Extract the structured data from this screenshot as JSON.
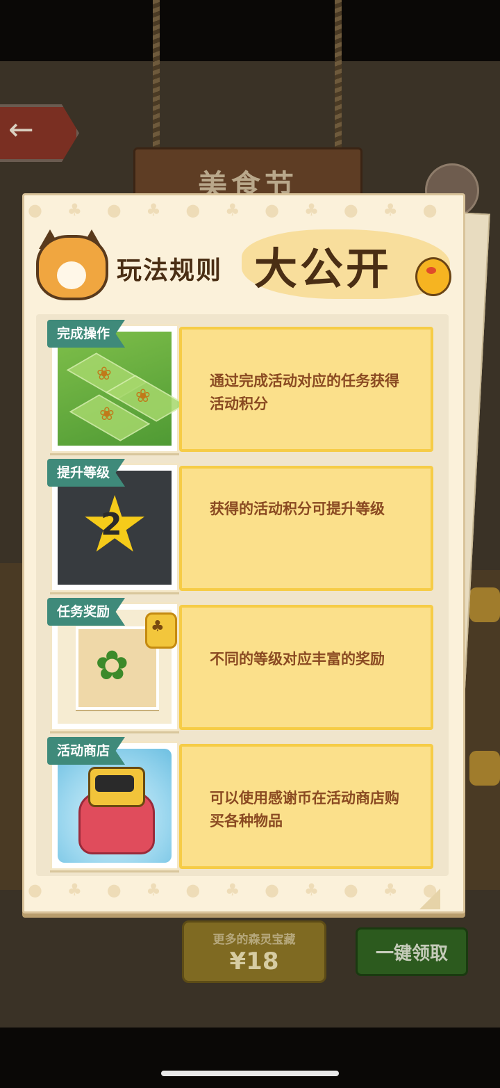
{
  "background": {
    "back_icon": "arrow-left-icon",
    "festival_title": "美食节",
    "more_treasure": {
      "label": "更多的森灵宝藏",
      "price": "¥18"
    },
    "claim_all_label": "一键领取"
  },
  "panel": {
    "title_small": "玩法规则",
    "title_big": "大公开",
    "rules": [
      {
        "tag": "完成操作",
        "text": "通过完成活动对应的任务获得活动积分",
        "icon": "farm-tiles-icon"
      },
      {
        "tag": "提升等级",
        "text": "获得的活动积分可提升等级",
        "icon": "star-level-icon",
        "level": "2"
      },
      {
        "tag": "任务奖励",
        "text": "不同的等级对应丰富的奖励",
        "icon": "plant-reward-icon",
        "lock_icon": "club-lock-icon"
      },
      {
        "tag": "活动商店",
        "text": "可以使用感谢币在活动商店购买各种物品",
        "icon": "robot-shop-icon"
      }
    ]
  },
  "colors": {
    "panel_bg": "#fbf1da",
    "tag_teal": "#3f8a7a",
    "rule_box": "#fbe08b",
    "rule_text": "#8a4a22",
    "title_text": "#4a2e14"
  }
}
